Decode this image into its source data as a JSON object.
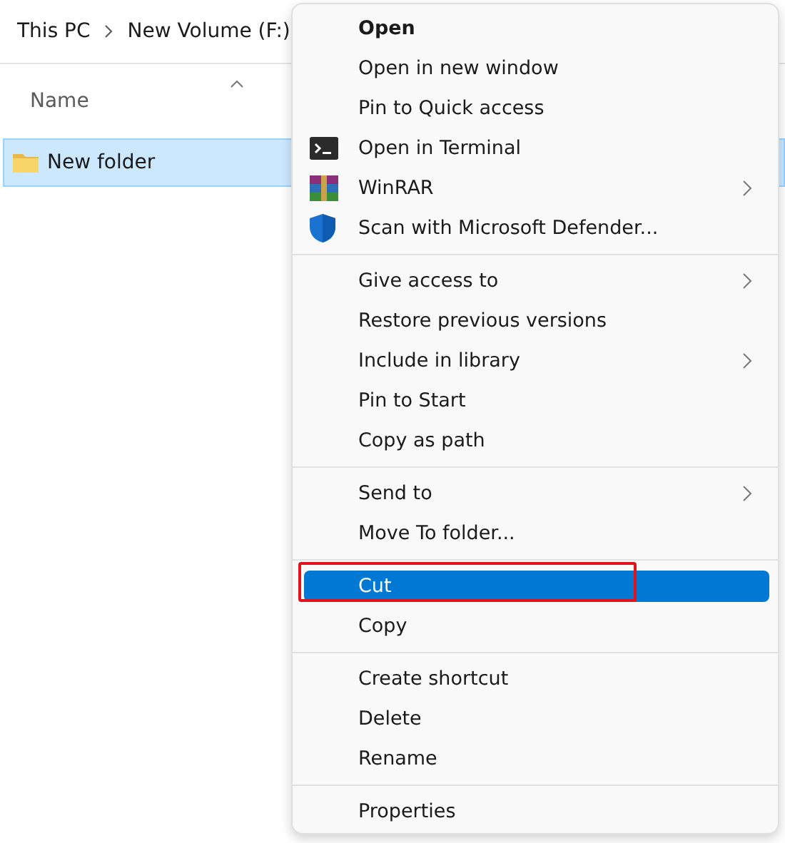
{
  "breadcrumb": [
    "This PC",
    "New Volume (F:)"
  ],
  "columns": [
    {
      "label": "Name",
      "sorted": true
    }
  ],
  "files": [
    {
      "name": "New folder",
      "selected": true
    }
  ],
  "context_menu": {
    "groups": [
      [
        {
          "label": "Open",
          "default": true,
          "submenu": false,
          "selected": false
        },
        {
          "label": "Open in new window",
          "default": false,
          "submenu": false,
          "selected": false
        },
        {
          "label": "Pin to Quick access",
          "default": false,
          "submenu": false,
          "selected": false
        },
        {
          "label": "Open in Terminal",
          "default": false,
          "kind": "terminal",
          "submenu": false,
          "selected": false
        },
        {
          "label": "WinRAR",
          "default": false,
          "kind": "archive",
          "submenu": true,
          "selected": false
        },
        {
          "label": "Scan with Microsoft Defender...",
          "default": false,
          "kind": "shield",
          "submenu": false,
          "selected": false
        }
      ],
      [
        {
          "label": "Give access to",
          "default": false,
          "kind": "plain",
          "submenu": true,
          "selected": false
        },
        {
          "label": "Restore previous versions",
          "default": false,
          "kind": "plain",
          "submenu": false,
          "selected": false
        },
        {
          "label": "Include in library",
          "default": false,
          "kind": "plain",
          "submenu": true,
          "selected": false
        },
        {
          "label": "Pin to Start",
          "default": false,
          "kind": "plain",
          "submenu": false,
          "selected": false
        },
        {
          "label": "Copy as path",
          "default": false,
          "kind": "plain",
          "submenu": false,
          "selected": false
        }
      ],
      [
        {
          "label": "Send to",
          "default": false,
          "kind": "plain",
          "submenu": true,
          "selected": false
        },
        {
          "label": "Move To folder...",
          "default": false,
          "kind": "plain",
          "submenu": false,
          "selected": false
        }
      ],
      [
        {
          "label": "Cut",
          "default": false,
          "kind": "plain",
          "submenu": false,
          "selected": true,
          "annotated": true
        },
        {
          "label": "Copy",
          "default": false,
          "kind": "plain",
          "submenu": false,
          "selected": false
        }
      ],
      [
        {
          "label": "Create shortcut",
          "default": false,
          "kind": "plain",
          "submenu": false,
          "selected": false
        },
        {
          "label": "Delete",
          "default": false,
          "kind": "plain",
          "submenu": false,
          "selected": false
        },
        {
          "label": "Rename",
          "default": false,
          "kind": "plain",
          "submenu": false,
          "selected": false
        }
      ],
      [
        {
          "label": "Properties",
          "default": false,
          "kind": "plain",
          "submenu": false,
          "selected": false
        }
      ]
    ]
  }
}
